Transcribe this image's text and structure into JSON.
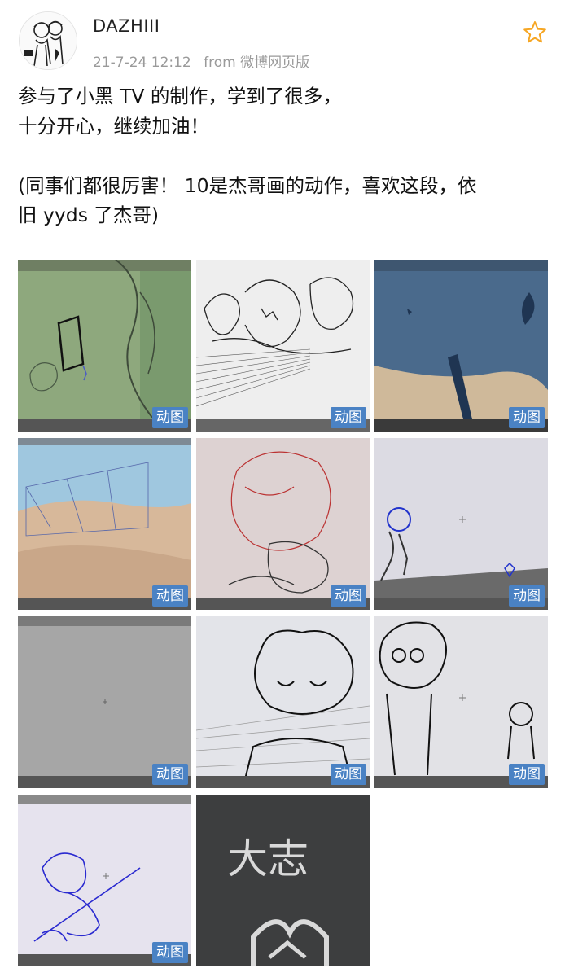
{
  "post": {
    "author": "DAZHIII",
    "date": "21-7-24 12:12",
    "source": "from 微博网页版",
    "text_lines": [
      "参与了小黑 TV 的制作，学到了很多，",
      "十分开心，继续加油！",
      "",
      "(同事们都很厉害！ 10是杰哥画的动作，喜欢这段，依",
      "旧 yyds 了杰哥)"
    ],
    "favorite_icon": "star-outline-icon"
  },
  "images": [
    {
      "badge": "动图"
    },
    {
      "badge": "动图"
    },
    {
      "badge": "动图"
    },
    {
      "badge": "动图"
    },
    {
      "badge": "动图"
    },
    {
      "badge": "动图"
    },
    {
      "badge": "动图"
    },
    {
      "badge": "动图"
    },
    {
      "badge": "动图"
    },
    {
      "badge": "动图"
    },
    {
      "overlay_text": "大志"
    }
  ],
  "colors": {
    "badge_bg": "#4a82c4",
    "star": "#f6a623",
    "meta_text": "#9a9a9a"
  }
}
